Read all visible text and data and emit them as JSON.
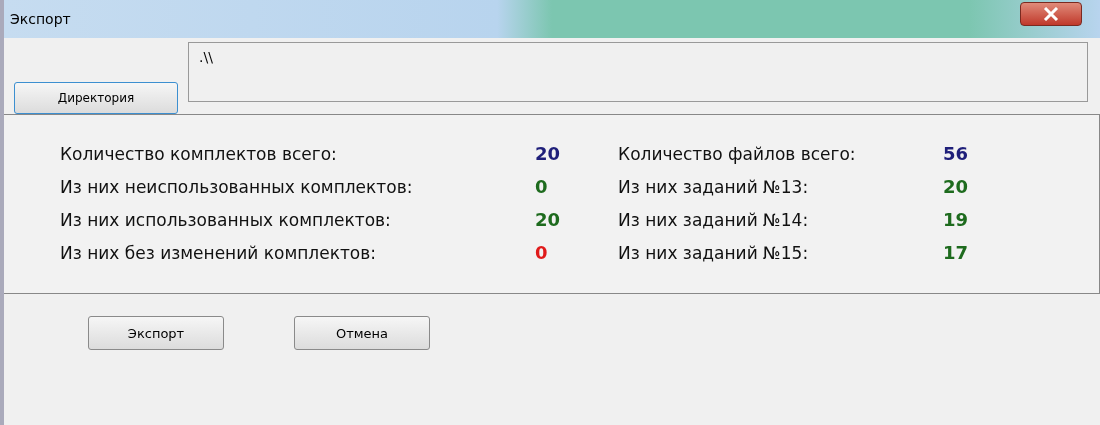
{
  "window": {
    "title": "Экспорт"
  },
  "directory": {
    "button": "Директория",
    "value": ".\\\\"
  },
  "stats_left": [
    {
      "label": "Количество комплектов всего:",
      "value": "20",
      "color": "#1f1f7a"
    },
    {
      "label": "Из них неиспользованных комплектов:",
      "value": "0",
      "color": "#1e6b1e"
    },
    {
      "label": "Из них использованных комплектов:",
      "value": "20",
      "color": "#1e6b1e"
    },
    {
      "label": "Из них без изменений комплектов:",
      "value": "0",
      "color": "#e01b1b"
    }
  ],
  "stats_right": [
    {
      "label": "Количество файлов всего:",
      "value": "56",
      "color": "#1f1f7a"
    },
    {
      "label": "Из них заданий №13:",
      "value": "20",
      "color": "#1e6b1e"
    },
    {
      "label": "Из них заданий №14:",
      "value": "19",
      "color": "#1e6b1e"
    },
    {
      "label": "Из них заданий №15:",
      "value": "17",
      "color": "#1e6b1e"
    }
  ],
  "buttons": [
    "Экспорт",
    "Отмена"
  ]
}
